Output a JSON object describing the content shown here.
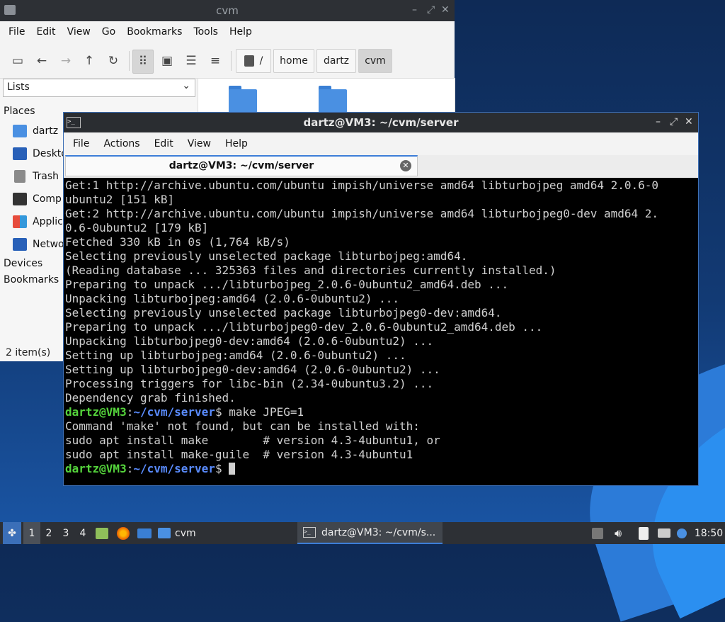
{
  "file_manager": {
    "title": "cvm",
    "menu": [
      "File",
      "Edit",
      "View",
      "Go",
      "Bookmarks",
      "Tools",
      "Help"
    ],
    "breadcrumb": [
      "/",
      "home",
      "dartz",
      "cvm"
    ],
    "side_pane_mode": "Lists",
    "places_header": "Places",
    "places": [
      {
        "label": "dartz",
        "icon": "home-folder-icon"
      },
      {
        "label": "Deskto",
        "icon": "desktop-icon"
      },
      {
        "label": "Trash",
        "icon": "trash-icon"
      },
      {
        "label": "Comp",
        "icon": "computer-icon"
      },
      {
        "label": "Applic",
        "icon": "applications-icon"
      },
      {
        "label": "Netwo",
        "icon": "network-icon"
      }
    ],
    "devices_header": "Devices",
    "bookmarks_header": "Bookmarks",
    "status": "2 item(s)"
  },
  "terminal": {
    "title": "dartz@VM3: ~/cvm/server",
    "menu": [
      "File",
      "Actions",
      "Edit",
      "View",
      "Help"
    ],
    "tab_label": "dartz@VM3: ~/cvm/server",
    "output_lines": [
      "Get:1 http://archive.ubuntu.com/ubuntu impish/universe amd64 libturbojpeg amd64 2.0.6-0",
      "ubuntu2 [151 kB]",
      "Get:2 http://archive.ubuntu.com/ubuntu impish/universe amd64 libturbojpeg0-dev amd64 2.",
      "0.6-0ubuntu2 [179 kB]",
      "Fetched 330 kB in 0s (1,764 kB/s)",
      "Selecting previously unselected package libturbojpeg:amd64.",
      "(Reading database ... 325363 files and directories currently installed.)",
      "Preparing to unpack .../libturbojpeg_2.0.6-0ubuntu2_amd64.deb ...",
      "Unpacking libturbojpeg:amd64 (2.0.6-0ubuntu2) ...",
      "Selecting previously unselected package libturbojpeg0-dev:amd64.",
      "Preparing to unpack .../libturbojpeg0-dev_2.0.6-0ubuntu2_amd64.deb ...",
      "Unpacking libturbojpeg0-dev:amd64 (2.0.6-0ubuntu2) ...",
      "Setting up libturbojpeg:amd64 (2.0.6-0ubuntu2) ...",
      "Setting up libturbojpeg0-dev:amd64 (2.0.6-0ubuntu2) ...",
      "Processing triggers for libc-bin (2.34-0ubuntu3.2) ...",
      "Dependency grab finished."
    ],
    "prompt_user": "dartz@VM3",
    "prompt_path": "~/cvm/server",
    "command": "make JPEG=1",
    "after_lines": [
      "Command 'make' not found, but can be installed with:",
      "sudo apt install make        # version 4.3-4ubuntu1, or",
      "sudo apt install make-guile  # version 4.3-4ubuntu1"
    ]
  },
  "taskbar": {
    "workspaces": [
      "1",
      "2",
      "3",
      "4"
    ],
    "active_workspace": "1",
    "cvm_label": "cvm",
    "terminal_task_label": "dartz@VM3: ~/cvm/s...",
    "clock": "18:50"
  },
  "colors": {
    "prompt_user": "#55d43c",
    "prompt_path": "#5a8cff",
    "accent": "#3d7ed8"
  }
}
